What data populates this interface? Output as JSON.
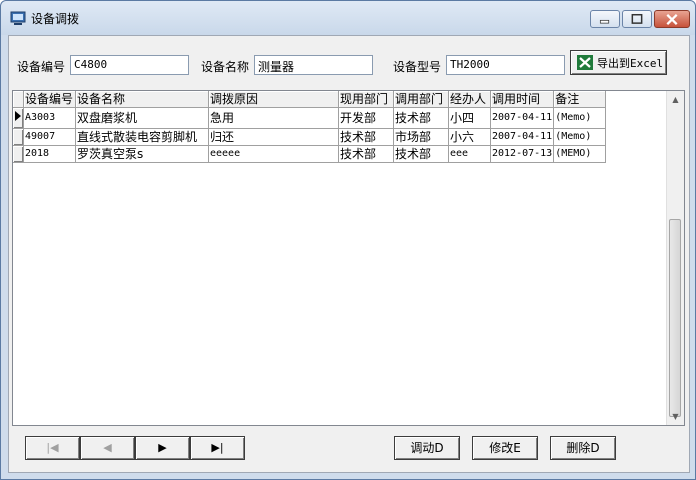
{
  "window": {
    "title": "设备调拨"
  },
  "filters": {
    "code_label": "设备编号",
    "code_value": "C4800",
    "name_label": "设备名称",
    "name_value": "测量器",
    "model_label": "设备型号",
    "model_value": "TH2000"
  },
  "export_label": "导出到Excel",
  "table": {
    "columns": [
      "设备编号",
      "设备名称",
      "调拨原因",
      "现用部门",
      "调用部门",
      "经办人",
      "调用时间",
      "备注"
    ],
    "rows": [
      [
        "A3003",
        "双盘磨浆机",
        "急用",
        "开发部",
        "技术部",
        "小四",
        "2007-04-11",
        "(Memo)"
      ],
      [
        "49007",
        "直线式散装电容剪脚机",
        "归还",
        "技术部",
        "市场部",
        "小六",
        "2007-04-11",
        "(Memo)"
      ],
      [
        "2018",
        "罗茨真空泵s",
        "eeeee",
        "技术部",
        "技术部",
        "eee",
        "2012-07-13",
        "(MEMO)"
      ]
    ]
  },
  "nav": {
    "first": "|◀",
    "prev": "◀",
    "next": "▶",
    "last": "▶|"
  },
  "actions": {
    "transfer": "调动D",
    "modify": "修改E",
    "delete": "删除D"
  },
  "icons": {
    "app": "window-icon",
    "excel": "excel-icon"
  }
}
